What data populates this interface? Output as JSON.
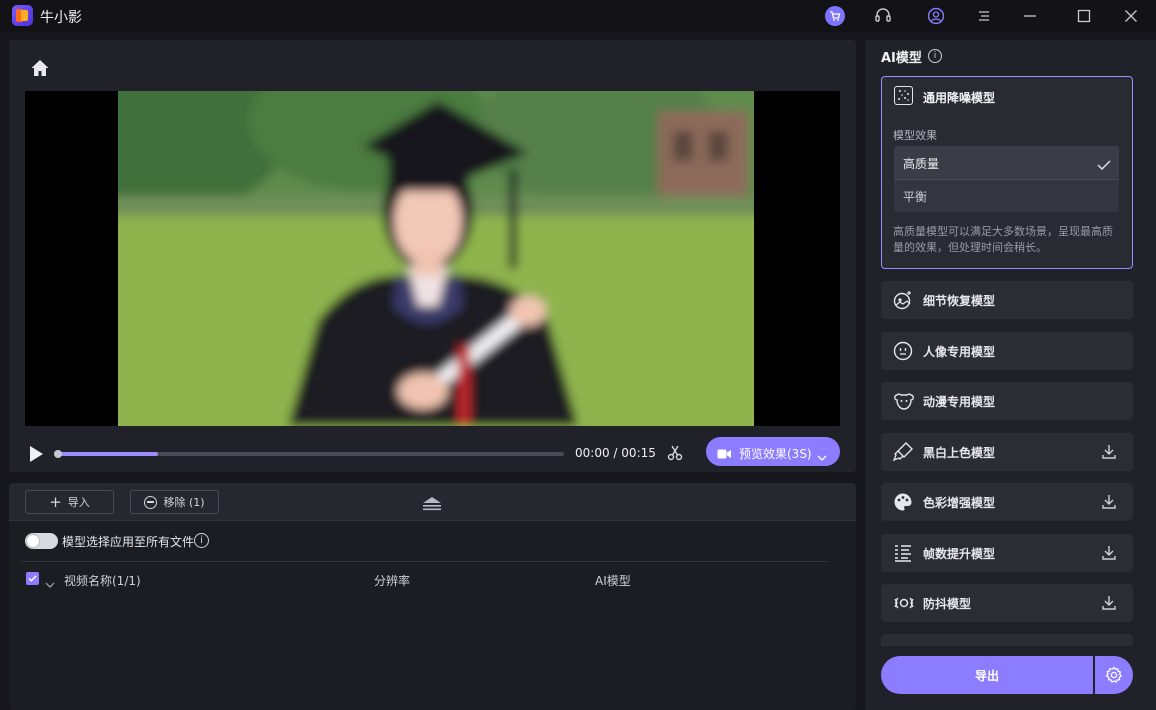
{
  "app": {
    "title": "牛小影"
  },
  "player": {
    "time_current": "00:00",
    "time_separator": "/",
    "time_total": "00:15",
    "progress": 0.2,
    "preview_label": "预览效果(3S)"
  },
  "toolbar": {
    "import_label": "导入",
    "remove_label": "移除 (1)"
  },
  "options": {
    "apply_all_label": "模型选择应用至所有文件",
    "apply_all_enabled": false
  },
  "file_table": {
    "col_name": "视频名称(1/1)",
    "col_resolution": "分辨率",
    "col_model": "AI模型",
    "checked": true
  },
  "ai_panel": {
    "title": "AI模型",
    "selected_model": {
      "name": "通用降噪模型",
      "effect_label": "模型效果",
      "options": [
        {
          "label": "高质量",
          "selected": true
        },
        {
          "label": "平衡",
          "selected": false
        }
      ],
      "description": "高质量模型可以满足大多数场景，呈现最高质量的效果，但处理时间会稍长。"
    },
    "models": [
      {
        "name": "细节恢复模型",
        "icon": "detail-restore-icon",
        "downloadable": false
      },
      {
        "name": "人像专用模型",
        "icon": "portrait-icon",
        "downloadable": false
      },
      {
        "name": "动漫专用模型",
        "icon": "anime-icon",
        "downloadable": false
      },
      {
        "name": "黑白上色模型",
        "icon": "colorize-icon",
        "downloadable": true
      },
      {
        "name": "色彩增强模型",
        "icon": "palette-icon",
        "downloadable": true
      },
      {
        "name": "帧数提升模型",
        "icon": "frame-rate-icon",
        "downloadable": true
      },
      {
        "name": "防抖模型",
        "icon": "stabilize-icon",
        "downloadable": true
      }
    ],
    "export_label": "导出"
  },
  "colors": {
    "accent": "#8c7cff",
    "selected_border": "#9b8cff",
    "panel_bg": "#212129"
  }
}
